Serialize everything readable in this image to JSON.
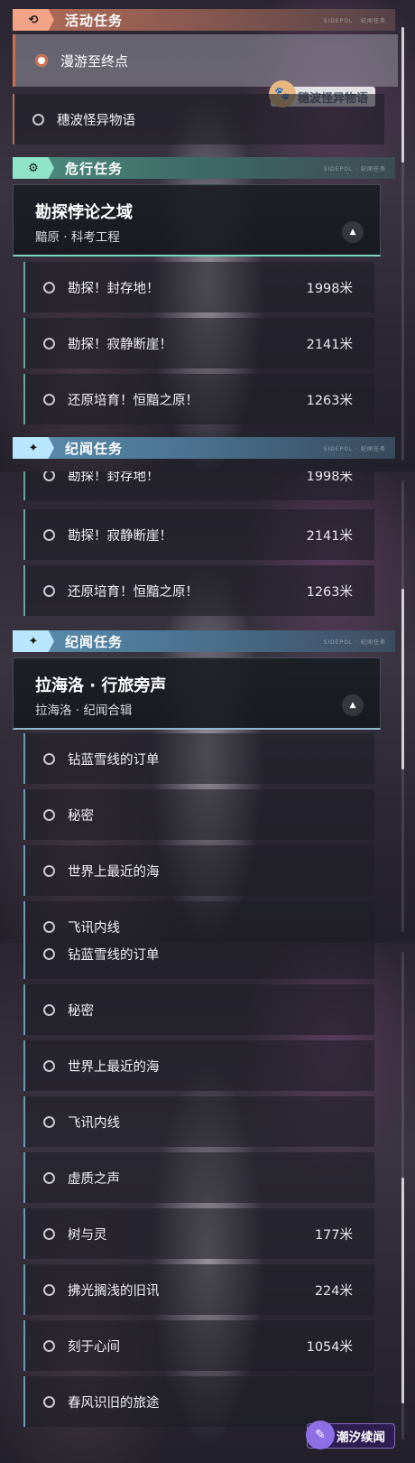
{
  "categories": {
    "activity": "活动任务",
    "danger": "危行任务",
    "chronicle": "纪闻任务"
  },
  "header_deco": "SIDEPOL · 纪闻任务",
  "activity_tasks": [
    "漫游至终点",
    "穗波怪异物语"
  ],
  "badge_text": "穗波怪异物语",
  "danger_card": {
    "title": "勘探悖论之域",
    "subtitle": "黯原 · 科考工程"
  },
  "danger_tasks": [
    {
      "name": "勘探！封存地！",
      "dist": "1998米"
    },
    {
      "name": "勘探！寂静断崖！",
      "dist": "2141米"
    },
    {
      "name": "还原培育！恒黯之原！",
      "dist": "1263米"
    }
  ],
  "chronicle_card": {
    "title": "拉海洛 · 行旅旁声",
    "subtitle": "拉海洛 · 纪闻合辑"
  },
  "chronicle_tasks": [
    {
      "name": "钻蓝雪线的订单",
      "dist": ""
    },
    {
      "name": "秘密",
      "dist": ""
    },
    {
      "name": "世界上最近的海",
      "dist": ""
    },
    {
      "name": "飞讯内线",
      "dist": ""
    },
    {
      "name": "虚质之声",
      "dist": ""
    },
    {
      "name": "树与灵",
      "dist": "177米"
    },
    {
      "name": "拂光搁浅的旧讯",
      "dist": "224米"
    },
    {
      "name": "刻于心间",
      "dist": "1054米"
    },
    {
      "name": "春风识旧的旅途",
      "dist": ""
    }
  ],
  "footer_badge": "潮汐续闻",
  "icons": {
    "activity": "refresh-icon",
    "danger": "alert-gear-icon",
    "chronicle": "sparkle-icon",
    "expand": "triangle-up-icon",
    "badge": "critter-icon",
    "footer": "tidal-icon"
  }
}
